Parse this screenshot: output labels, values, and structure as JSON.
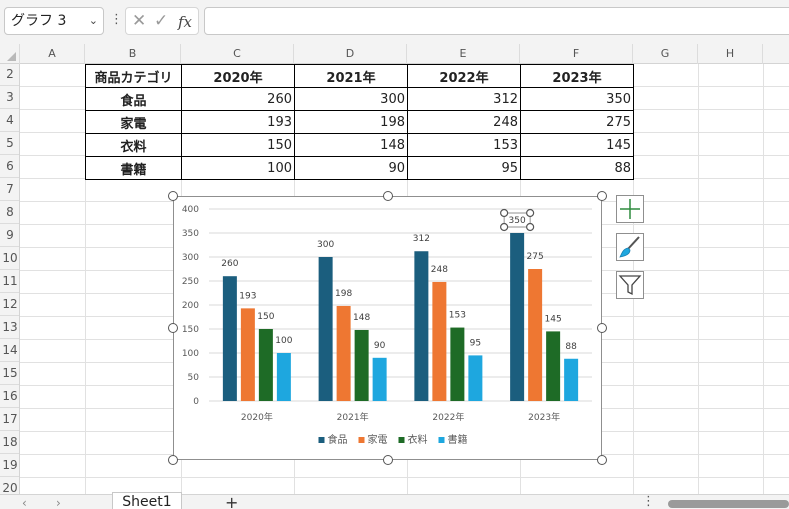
{
  "formula_bar": {
    "name_box": "グラフ 3",
    "fx_label": "fx",
    "formula": ""
  },
  "columns": [
    "A",
    "B",
    "C",
    "D",
    "E",
    "F",
    "G",
    "H"
  ],
  "rows": [
    "2",
    "3",
    "4",
    "5",
    "6",
    "7",
    "8",
    "9",
    "10",
    "11",
    "12",
    "13",
    "14",
    "15",
    "16",
    "17",
    "18",
    "19",
    "20"
  ],
  "table": {
    "header": [
      "商品カテゴリ",
      "2020年",
      "2021年",
      "2022年",
      "2023年"
    ],
    "rows": [
      {
        "category": "食品",
        "values": [
          "260",
          "300",
          "312",
          "350"
        ]
      },
      {
        "category": "家電",
        "values": [
          "193",
          "198",
          "248",
          "275"
        ]
      },
      {
        "category": "衣料",
        "values": [
          "150",
          "148",
          "153",
          "145"
        ]
      },
      {
        "category": "書籍",
        "values": [
          "100",
          "90",
          "95",
          "88"
        ]
      }
    ]
  },
  "chart_data": {
    "type": "bar",
    "categories": [
      "2020年",
      "2021年",
      "2022年",
      "2023年"
    ],
    "series": [
      {
        "name": "食品",
        "color": "#1b5e7e",
        "values": [
          260,
          300,
          312,
          350
        ]
      },
      {
        "name": "家電",
        "color": "#ee7732",
        "values": [
          193,
          198,
          248,
          275
        ]
      },
      {
        "name": "衣料",
        "color": "#1e6b26",
        "values": [
          150,
          148,
          153,
          145
        ]
      },
      {
        "name": "書籍",
        "color": "#1ea7df",
        "values": [
          100,
          90,
          95,
          88
        ]
      }
    ],
    "yticks": [
      "0",
      "50",
      "100",
      "150",
      "200",
      "250",
      "300",
      "350",
      "400"
    ],
    "ylim": [
      0,
      400
    ],
    "grid": true,
    "data_labels": true,
    "legend": "bottom",
    "selected_label": "350"
  },
  "sheet_tabs": {
    "active": "Sheet1",
    "add_label": "+"
  },
  "icons": {
    "add_element": "plus-icon",
    "style": "brush-icon",
    "filter": "filter-icon"
  }
}
